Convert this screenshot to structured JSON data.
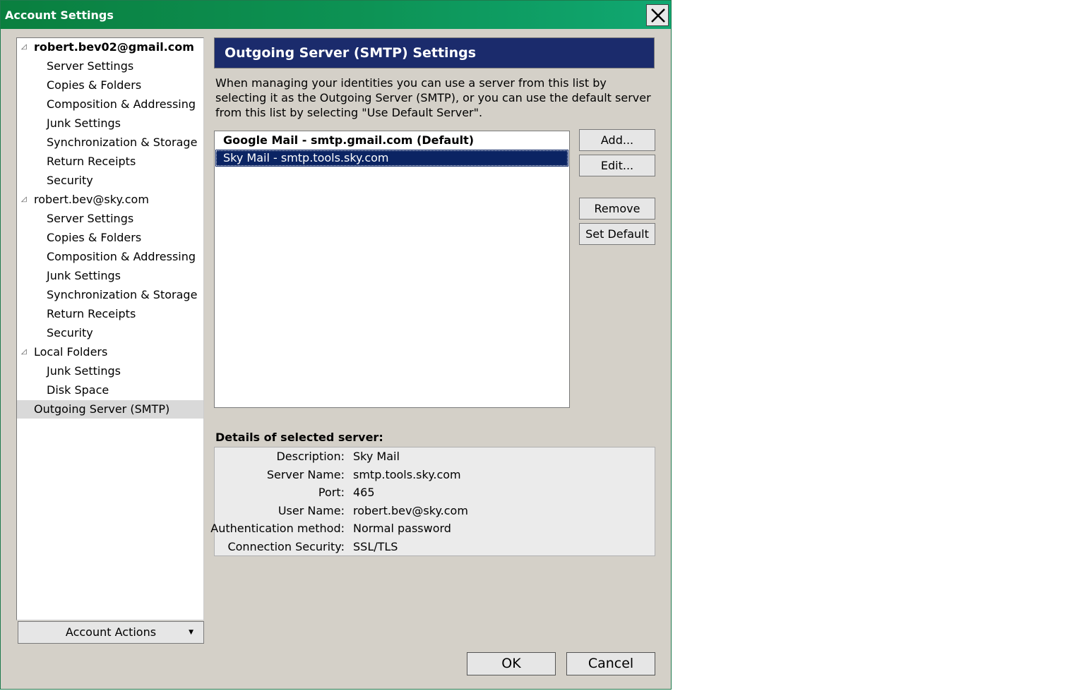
{
  "window": {
    "title": "Account Settings"
  },
  "tree": {
    "items": [
      {
        "label": "robert.bev02@gmail.com",
        "level": 0,
        "bold": true
      },
      {
        "label": "Server Settings",
        "level": 1
      },
      {
        "label": "Copies & Folders",
        "level": 1
      },
      {
        "label": "Composition & Addressing",
        "level": 1
      },
      {
        "label": "Junk Settings",
        "level": 1
      },
      {
        "label": "Synchronization & Storage",
        "level": 1
      },
      {
        "label": "Return Receipts",
        "level": 1
      },
      {
        "label": "Security",
        "level": 1
      },
      {
        "label": "robert.bev@sky.com",
        "level": 0
      },
      {
        "label": "Server Settings",
        "level": 1
      },
      {
        "label": "Copies & Folders",
        "level": 1
      },
      {
        "label": "Composition & Addressing",
        "level": 1
      },
      {
        "label": "Junk Settings",
        "level": 1
      },
      {
        "label": "Synchronization & Storage",
        "level": 1
      },
      {
        "label": "Return Receipts",
        "level": 1
      },
      {
        "label": "Security",
        "level": 1
      },
      {
        "label": "Local Folders",
        "level": 0
      },
      {
        "label": "Junk Settings",
        "level": 1
      },
      {
        "label": "Disk Space",
        "level": 1
      },
      {
        "label": "Outgoing Server (SMTP)",
        "level": 0,
        "selected": true
      }
    ],
    "account_actions": "Account Actions"
  },
  "panel": {
    "title": "Outgoing Server (SMTP) Settings",
    "description": "When managing your identities you can use a server from this list by selecting it as the Outgoing Server (SMTP), or you can use the default server from this list by selecting \"Use Default Server\".",
    "servers": [
      {
        "label": "Google Mail - smtp.gmail.com (Default)",
        "default": true
      },
      {
        "label": "Sky Mail - smtp.tools.sky.com",
        "selected": true
      }
    ],
    "buttons": {
      "add": "Add...",
      "edit": "Edit...",
      "remove": "Remove",
      "set_default": "Set Default"
    },
    "details_label": "Details of selected server:",
    "details": [
      {
        "label": "Description:",
        "value": "Sky Mail"
      },
      {
        "label": "Server Name:",
        "value": "smtp.tools.sky.com"
      },
      {
        "label": "Port:",
        "value": "465"
      },
      {
        "label": "User Name:",
        "value": "robert.bev@sky.com"
      },
      {
        "label": "Authentication method:",
        "value": "Normal password"
      },
      {
        "label": "Connection Security:",
        "value": "SSL/TLS"
      }
    ]
  },
  "footer": {
    "ok": "OK",
    "cancel": "Cancel"
  },
  "colors": {
    "titlebar": "#0d9355",
    "header": "#1b2b6c",
    "selection": "#0b2463",
    "dialog_bg": "#d4d0c8"
  }
}
